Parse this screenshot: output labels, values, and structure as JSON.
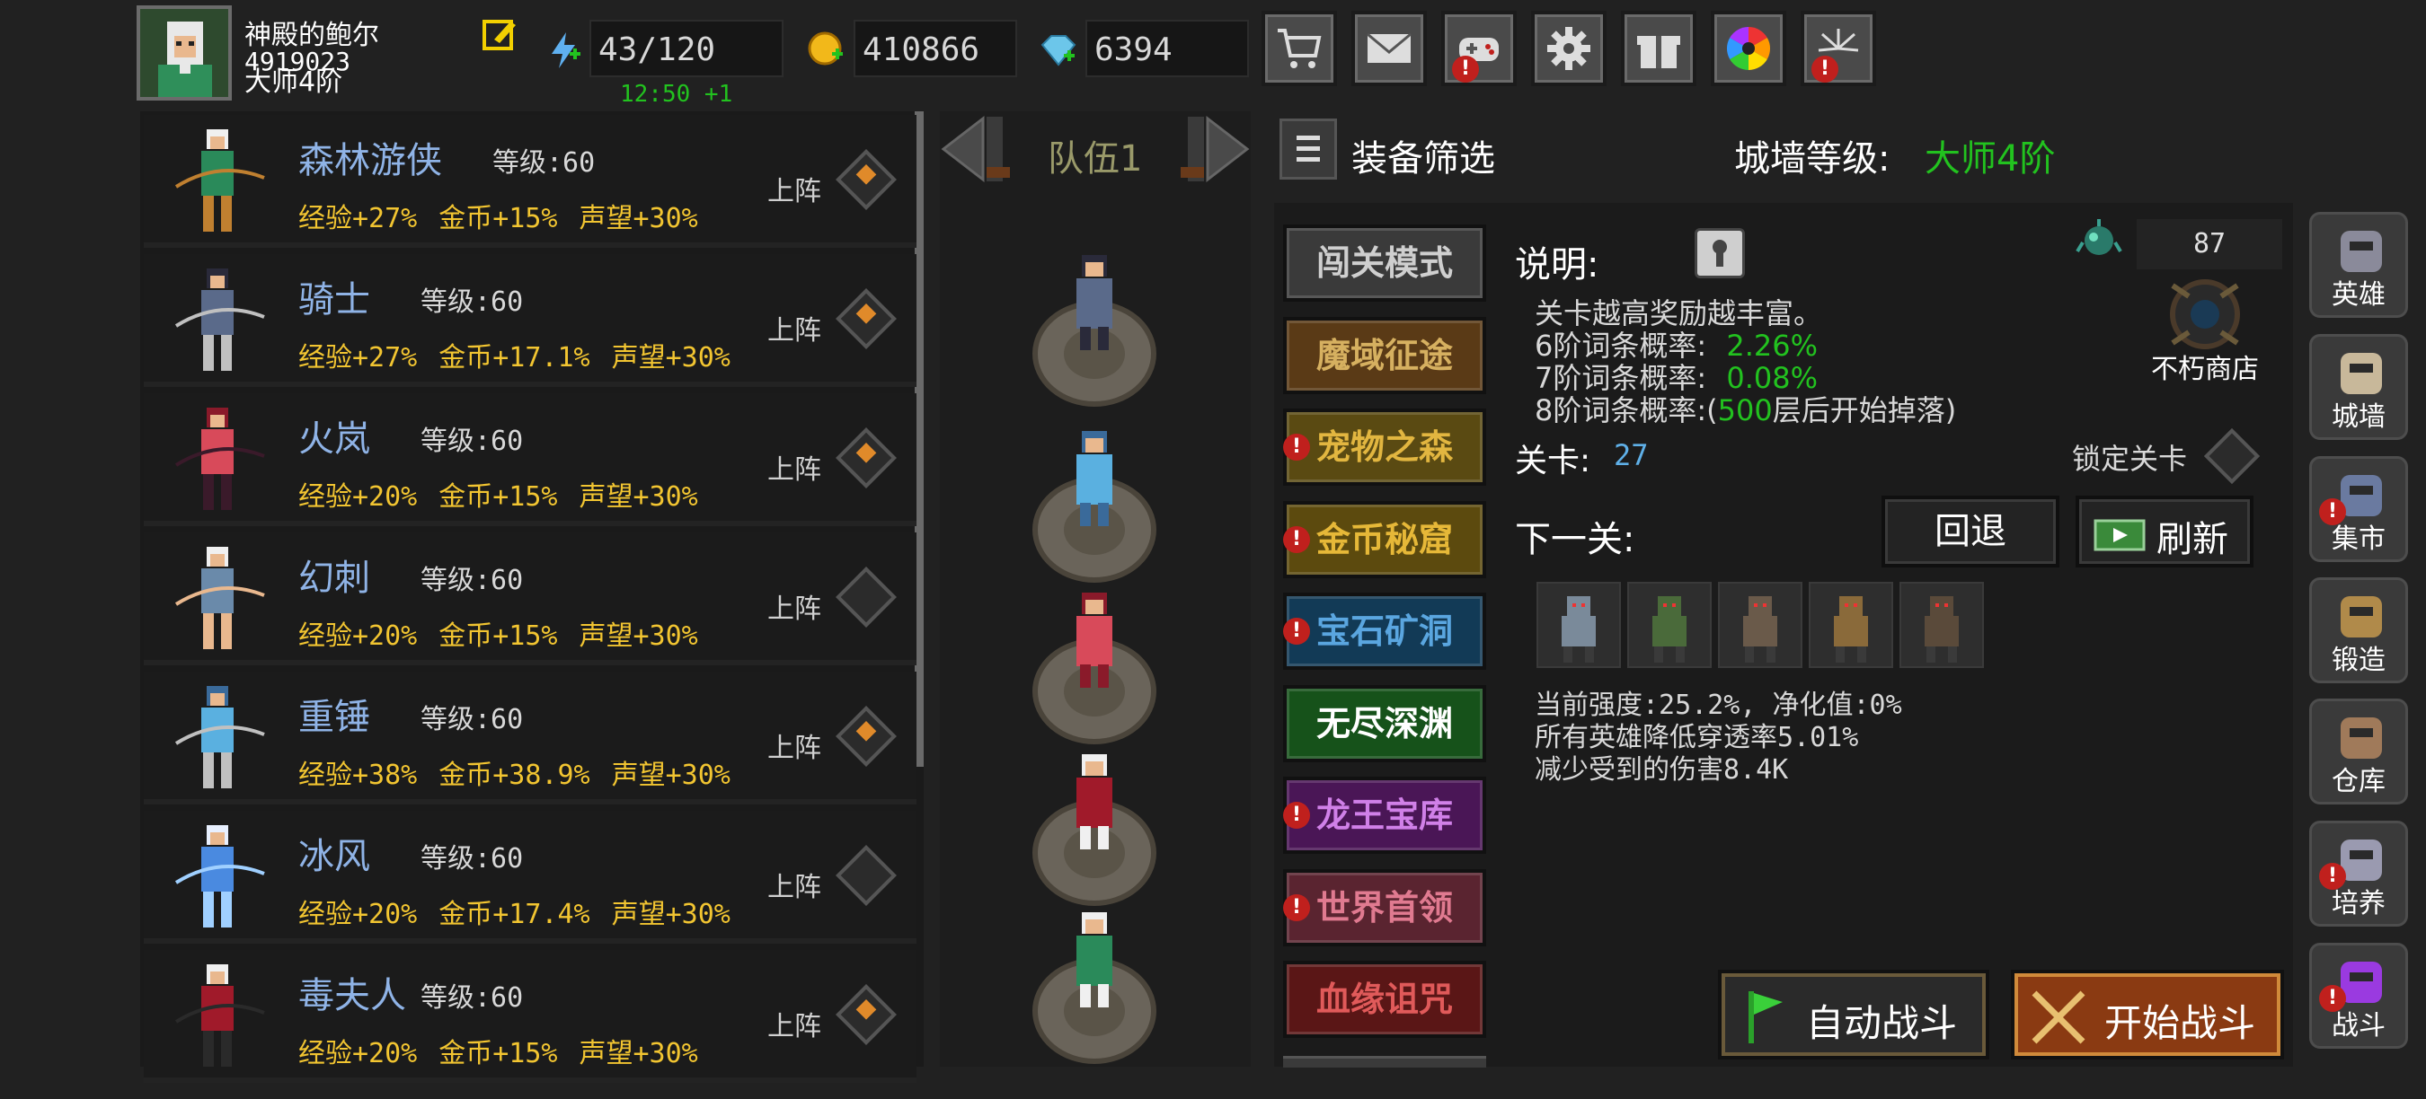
{
  "player": {
    "name": "神殿的鲍尔",
    "id": "4919023",
    "rank": "大师4阶"
  },
  "resources": {
    "energy": "43/120",
    "energy_timer": "12:50 +1",
    "gold": "410866",
    "gems": "6394"
  },
  "top_buttons": [
    {
      "icon": "cart-icon",
      "badge": false
    },
    {
      "icon": "mail-icon",
      "badge": false
    },
    {
      "icon": "gamepad-icon",
      "badge": true
    },
    {
      "icon": "gear-icon",
      "badge": false
    },
    {
      "icon": "gift-icon",
      "badge": false
    },
    {
      "icon": "color-wheel-icon",
      "badge": false
    },
    {
      "icon": "fireworks-icon",
      "badge": true
    }
  ],
  "badge_text": "!",
  "heroes": [
    {
      "name": "森林游侠",
      "level": "等级:60",
      "exp": "经验+27%",
      "gold": "金币+15%",
      "fame": "声望+30%",
      "deploy": "上阵",
      "deployed": true
    },
    {
      "name": "骑士",
      "level": "等级:60",
      "exp": "经验+27%",
      "gold": "金币+17.1%",
      "fame": "声望+30%",
      "deploy": "上阵",
      "deployed": true
    },
    {
      "name": "火岚",
      "level": "等级:60",
      "exp": "经验+20%",
      "gold": "金币+15%",
      "fame": "声望+30%",
      "deploy": "上阵",
      "deployed": true
    },
    {
      "name": "幻刺",
      "level": "等级:60",
      "exp": "经验+20%",
      "gold": "金币+15%",
      "fame": "声望+30%",
      "deploy": "上阵",
      "deployed": false
    },
    {
      "name": "重锤",
      "level": "等级:60",
      "exp": "经验+38%",
      "gold": "金币+38.9%",
      "fame": "声望+30%",
      "deploy": "上阵",
      "deployed": true
    },
    {
      "name": "冰风",
      "level": "等级:60",
      "exp": "经验+20%",
      "gold": "金币+17.4%",
      "fame": "声望+30%",
      "deploy": "上阵",
      "deployed": false
    },
    {
      "name": "毒夫人",
      "level": "等级:60",
      "exp": "经验+20%",
      "gold": "金币+15%",
      "fame": "声望+30%",
      "deploy": "上阵",
      "deployed": true
    }
  ],
  "team": {
    "label": "队伍1"
  },
  "filter": {
    "label": "装备筛选"
  },
  "wall": {
    "label": "城墙等级:",
    "value": "大师4阶"
  },
  "modes": [
    {
      "label": "闯关模式",
      "bg": "#3a3a3a",
      "color": "#cfcfcf",
      "badge": false
    },
    {
      "label": "魔域征途",
      "bg": "#5a3a16",
      "color": "#d6b060",
      "badge": false
    },
    {
      "label": "宠物之森",
      "bg": "#5a4a12",
      "color": "#e2b640",
      "badge": true
    },
    {
      "label": "金币秘窟",
      "bg": "#5c4a0e",
      "color": "#e6b838",
      "badge": true
    },
    {
      "label": "宝石矿洞",
      "bg": "#123a56",
      "color": "#5aa6e0",
      "badge": true
    },
    {
      "label": "无尽深渊",
      "bg": "#16521a",
      "color": "#ffffff",
      "badge": false
    },
    {
      "label": "龙王宝库",
      "bg": "#4a1656",
      "color": "#d080e8",
      "badge": true
    },
    {
      "label": "世界首领",
      "bg": "#5a2430",
      "color": "#e07a90",
      "badge": true
    },
    {
      "label": "血缘诅咒",
      "bg": "#5a1616",
      "color": "#e05a5a",
      "badge": false
    }
  ],
  "info": {
    "title": "说明:",
    "line1": "关卡越高奖励越丰富。",
    "r6_label": "6阶词条概率:",
    "r6_value": "2.26%",
    "r7_label": "7阶词条概率:",
    "r7_value": "0.08%",
    "r8_prefix": "8阶词条概率:(",
    "r8_value": "500",
    "r8_suffix": "层后开始掉落)",
    "currency_count": "87",
    "shop_label": "不朽商店",
    "stage_label": "关卡:",
    "stage_value": "27",
    "lock_label": "锁定关卡",
    "next_label": "下一关:",
    "back_button": "回退",
    "refresh_button": "刷新",
    "strength": "当前强度:25.2%, 净化值:0%",
    "armor": "所有英雄降低穿透率5.01%",
    "damage": "减少受到的伤害8.4K"
  },
  "battle": {
    "auto_label": "自动战斗",
    "start_label": "开始战斗"
  },
  "right_menu": [
    {
      "label": "英雄",
      "icon": "helmet-icon",
      "badge": false
    },
    {
      "label": "城墙",
      "icon": "castle-icon",
      "badge": false
    },
    {
      "label": "集市",
      "icon": "market-icon",
      "badge": true
    },
    {
      "label": "锻造",
      "icon": "anvil-icon",
      "badge": false
    },
    {
      "label": "仓库",
      "icon": "chest-icon",
      "badge": false
    },
    {
      "label": "培养",
      "icon": "chalice-icon",
      "badge": true
    },
    {
      "label": "战斗",
      "icon": "portal-icon",
      "badge": true
    }
  ],
  "colors": {
    "accent_green": "#22c21f",
    "gold_text": "#f2c531",
    "hero_name": "#8fb3e6",
    "badge_red": "#c0201d"
  }
}
